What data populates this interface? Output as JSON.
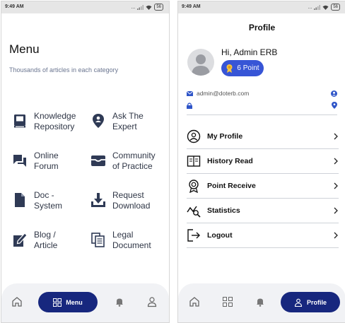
{
  "menu_screen": {
    "status": {
      "time": "9:49 AM",
      "icons_text": "...",
      "battery": "56"
    },
    "title": "Menu",
    "subtitle": "Thousands of articles in each category",
    "items": [
      {
        "label": "Knowledge\nRepository",
        "icon": "book-icon"
      },
      {
        "label": "Ask The\nExpert",
        "icon": "location-person-icon"
      },
      {
        "label": "Online\nForum",
        "icon": "chat-icon"
      },
      {
        "label": "Community\nof Practice",
        "icon": "inbox-icon"
      },
      {
        "label": "Doc -\nSystem",
        "icon": "document-icon"
      },
      {
        "label": "Request\nDownload",
        "icon": "download-icon"
      },
      {
        "label": "Blog /\nArticle",
        "icon": "edit-icon"
      },
      {
        "label": "Legal\nDocument",
        "icon": "documents-icon"
      }
    ],
    "nav": {
      "menu_label": "Menu"
    }
  },
  "profile_screen": {
    "status": {
      "time": "9:49 AM",
      "icons_text": "...",
      "battery": "56"
    },
    "title": "Profile",
    "greeting": "Hi, Admin ERB",
    "points": "6 Point",
    "email": "admin@doterb.com",
    "rows": [
      {
        "label": "My Profile",
        "icon": "user-circle-icon"
      },
      {
        "label": "History Read",
        "icon": "open-book-icon"
      },
      {
        "label": "Point Receive",
        "icon": "badge-icon"
      },
      {
        "label": "Statistics",
        "icon": "statistics-icon"
      },
      {
        "label": "Logout",
        "icon": "logout-icon"
      }
    ],
    "nav": {
      "profile_label": "Profile"
    }
  },
  "colors": {
    "navy": "#17277e",
    "blue": "#3755d6",
    "icon": "#2f3a55"
  }
}
